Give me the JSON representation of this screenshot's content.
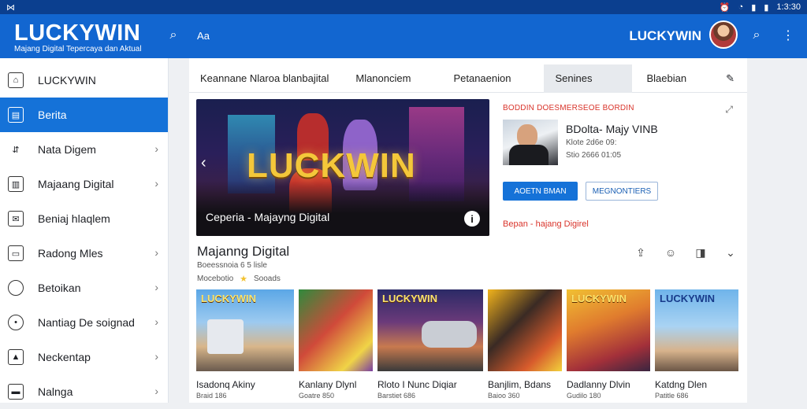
{
  "statusbar": {
    "left": "⋈",
    "time": "1:3:30"
  },
  "appbar": {
    "logo": "LUCKYWIN",
    "tagline": "Majang Digital Tepercaya dan Aktual",
    "user_label": "LUCKYWIN",
    "icons": [
      "search-icon",
      "translate-icon",
      "search-icon",
      "more-vert-icon"
    ]
  },
  "sidebar": {
    "items": [
      {
        "label": "LUCKYWIN",
        "icon": "home-icon"
      },
      {
        "label": "Berita",
        "icon": "news-icon",
        "active": true
      },
      {
        "label": "Nata Digem",
        "icon": "trend-icon"
      },
      {
        "label": "Majaang Digital",
        "icon": "grid-icon"
      },
      {
        "label": "Beniaj hlaqlem",
        "icon": "mail-icon"
      },
      {
        "label": "Radong Mles",
        "icon": "box-icon"
      },
      {
        "label": "Betoikan",
        "icon": "circle-icon"
      },
      {
        "label": "Nantiag De soignad",
        "icon": "location-icon"
      },
      {
        "label": "Neckentap",
        "icon": "image-icon"
      },
      {
        "label": "Nalnga",
        "icon": "inbox-icon"
      }
    ]
  },
  "tabs": [
    {
      "label": "Keannane Nlaroa blanbajital"
    },
    {
      "label": "Mlanonciem"
    },
    {
      "label": "Petanaenion"
    },
    {
      "label": "Senines",
      "active": true
    },
    {
      "label": "Blaebian"
    }
  ],
  "hero": {
    "logo": "LUCKWIN",
    "caption": "Ceperia - Majayng Digital",
    "info": "i"
  },
  "side_card": {
    "kicker": "BODDIN DOESMERSEOE BORDIN",
    "title": "BDolta- Majy VINB",
    "meta1": "Klote 2d6e 09:",
    "meta2": "Stio 2666 01:05",
    "primary_button": "AOETN BMAN",
    "secondary_button": "MEGNONTIERS",
    "footlink": "Bepan - hajang Digirel"
  },
  "section": {
    "title": "Majanng Digital",
    "subtitle": "Boeessnoia 6 5 lisle",
    "meta_left": "Mocebotio",
    "meta_right": "Sooads"
  },
  "cards": [
    {
      "label": "LUCKYWIN",
      "title": "Isadonq Akiny",
      "sub": "Braid 186"
    },
    {
      "label": "",
      "title": "Kanlany Dlynl",
      "sub": "Goatre 850"
    },
    {
      "label": "LUCKYWIN",
      "title": "Rloto I Nunc Diqiar",
      "sub": "Barstiet 686"
    },
    {
      "label": "",
      "title": "Banjlim, Bdans",
      "sub": "Baioo 360"
    },
    {
      "label": "LUCKYWIN",
      "title": "Dadlanny Dlvin",
      "sub": "Gudilo 180"
    },
    {
      "label": "LUCKYWIN",
      "title": "Katdng Dlen",
      "sub": "Patitle 686"
    }
  ]
}
